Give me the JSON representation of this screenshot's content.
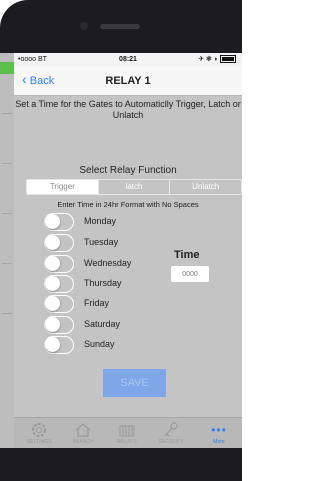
{
  "status": {
    "carrier": "•oooo BT",
    "time": "08:21",
    "right": "✈ ❃ ◗"
  },
  "nav": {
    "back_label": "Back",
    "title": "RELAY 1"
  },
  "instruction": "Set a Time for the Gates to Automaticlly Trigger, Latch or Unlatch",
  "relay_function": {
    "title": "Select Relay Function",
    "options": [
      "Trigger",
      "latch",
      "Unlatch"
    ],
    "selected": "Trigger"
  },
  "hint": "Enter Time in 24hr Format with No Spaces",
  "days": [
    {
      "label": "Monday",
      "on": false
    },
    {
      "label": "Tuesday",
      "on": false
    },
    {
      "label": "Wednesday",
      "on": false
    },
    {
      "label": "Thursday",
      "on": false
    },
    {
      "label": "Friday",
      "on": false
    },
    {
      "label": "Saturday",
      "on": false
    },
    {
      "label": "Sunday",
      "on": false
    }
  ],
  "time": {
    "label": "Time",
    "placeholder": "0000"
  },
  "save_label": "SAVE",
  "tabs": [
    {
      "label": "SETTINGS",
      "icon": "gear-icon"
    },
    {
      "label": "BRANCH",
      "icon": "home-icon"
    },
    {
      "label": "RELAYS",
      "icon": "gate-icon"
    },
    {
      "label": "SECURITY",
      "icon": "key-icon"
    },
    {
      "label": "More",
      "icon": "more-icon"
    }
  ],
  "colors": {
    "accent": "#2f7bf5",
    "save_button": "#7da7e6",
    "overlay": "#c4c4c4"
  }
}
